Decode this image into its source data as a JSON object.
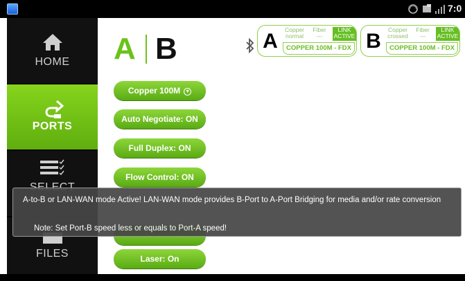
{
  "status_bar": {
    "time": "7:0",
    "icons": [
      "app-icon",
      "sync-icon",
      "tablet-icon",
      "signal-icon"
    ]
  },
  "sidebar": {
    "items": [
      {
        "label": "HOME",
        "icon": "home-icon",
        "selected": false
      },
      {
        "label": "PORTS",
        "icon": "ports-icon",
        "selected": true
      },
      {
        "label": "SELECT",
        "icon": "select-list-icon",
        "selected": false
      },
      {
        "label": "FILES",
        "icon": "files-icon",
        "selected": false
      }
    ],
    "selected_color": "#6cc21a"
  },
  "logo": {
    "a": "A",
    "b": "B"
  },
  "port_a": {
    "letter": "A",
    "cells": [
      {
        "line1": "Copper",
        "line2": "normal",
        "active": false
      },
      {
        "line1": "Fiber",
        "line2": "---",
        "active": false
      },
      {
        "line1": "LINK",
        "line2": "ACTIVE",
        "active": true
      }
    ],
    "status": "COPPER 100M  - FDX"
  },
  "port_b": {
    "letter": "B",
    "cells": [
      {
        "line1": "Copper",
        "line2": "crossed",
        "active": false
      },
      {
        "line1": "Fiber",
        "line2": "---",
        "active": false
      },
      {
        "line1": "LINK",
        "line2": "ACTIVE",
        "active": true
      }
    ],
    "status": "COPPER 100M  - FDX"
  },
  "buttons": {
    "speed": "Copper 100M",
    "auto_negotiate": "Auto Negotiate: ON",
    "full_duplex": "Full Duplex: ON",
    "flow_control": "Flow Control: ON",
    "laser": "Laser: On"
  },
  "toast": {
    "message": "A-to-B or LAN-WAN mode Active!  LAN-WAN mode provides B-Port to A-Port Bridging for media and/or rate conversion",
    "note": "Note: Set Port-B speed less or equals to Port-A speed!"
  },
  "colors": {
    "accent": "#6cc21a",
    "toast_bg": "#464646"
  }
}
